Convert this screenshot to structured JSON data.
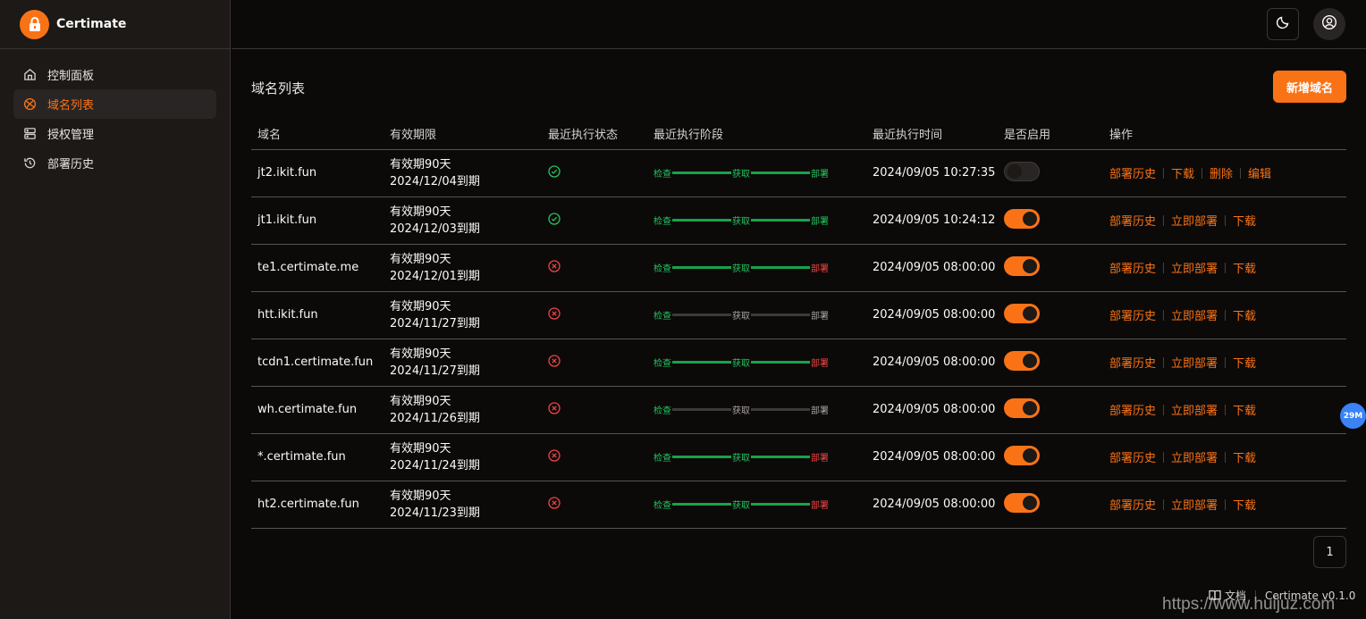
{
  "brand": {
    "name": "Certimate"
  },
  "sidebar": {
    "items": [
      {
        "label": "控制面板",
        "icon": "home-icon",
        "active": false
      },
      {
        "label": "域名列表",
        "icon": "globe-icon",
        "active": true
      },
      {
        "label": "授权管理",
        "icon": "server-icon",
        "active": false
      },
      {
        "label": "部署历史",
        "icon": "history-icon",
        "active": false
      }
    ]
  },
  "header": {
    "theme_icon": "moon-icon",
    "user_icon": "user-circle-icon"
  },
  "main": {
    "title": "域名列表",
    "add_button": "新增域名",
    "columns": [
      "域名",
      "有效期限",
      "最近执行状态",
      "最近执行阶段",
      "最近执行时间",
      "是否启用",
      "操作"
    ],
    "stage_labels": [
      "检查",
      "获取",
      "部署"
    ],
    "rows": [
      {
        "domain": "jt2.ikit.fun",
        "validity": "有效期90天",
        "expiry": "2024/12/04到期",
        "status": "success",
        "stages": [
          "green",
          "green",
          "green"
        ],
        "time": "2024/09/05 10:27:35",
        "enabled": false,
        "actions": [
          "部署历史",
          "下载",
          "删除",
          "编辑"
        ]
      },
      {
        "domain": "jt1.ikit.fun",
        "validity": "有效期90天",
        "expiry": "2024/12/03到期",
        "status": "success",
        "stages": [
          "green",
          "green",
          "green"
        ],
        "time": "2024/09/05 10:24:12",
        "enabled": true,
        "actions": [
          "部署历史",
          "立即部署",
          "下载"
        ]
      },
      {
        "domain": "te1.certimate.me",
        "validity": "有效期90天",
        "expiry": "2024/12/01到期",
        "status": "error",
        "stages": [
          "green",
          "green",
          "red"
        ],
        "time": "2024/09/05 08:00:00",
        "enabled": true,
        "actions": [
          "部署历史",
          "立即部署",
          "下载"
        ]
      },
      {
        "domain": "htt.ikit.fun",
        "validity": "有效期90天",
        "expiry": "2024/11/27到期",
        "status": "error",
        "stages": [
          "green",
          "grey",
          "grey"
        ],
        "time": "2024/09/05 08:00:00",
        "enabled": true,
        "actions": [
          "部署历史",
          "立即部署",
          "下载"
        ]
      },
      {
        "domain": "tcdn1.certimate.fun",
        "validity": "有效期90天",
        "expiry": "2024/11/27到期",
        "status": "error",
        "stages": [
          "green",
          "green",
          "red"
        ],
        "time": "2024/09/05 08:00:00",
        "enabled": true,
        "actions": [
          "部署历史",
          "立即部署",
          "下载"
        ]
      },
      {
        "domain": "wh.certimate.fun",
        "validity": "有效期90天",
        "expiry": "2024/11/26到期",
        "status": "error",
        "stages": [
          "green",
          "grey",
          "grey"
        ],
        "time": "2024/09/05 08:00:00",
        "enabled": true,
        "actions": [
          "部署历史",
          "立即部署",
          "下载"
        ]
      },
      {
        "domain": "*.certimate.fun",
        "validity": "有效期90天",
        "expiry": "2024/11/24到期",
        "status": "error",
        "stages": [
          "green",
          "green",
          "red"
        ],
        "time": "2024/09/05 08:00:00",
        "enabled": true,
        "actions": [
          "部署历史",
          "立即部署",
          "下载"
        ]
      },
      {
        "domain": "ht2.certimate.fun",
        "validity": "有效期90天",
        "expiry": "2024/11/23到期",
        "status": "error",
        "stages": [
          "green",
          "green",
          "red"
        ],
        "time": "2024/09/05 08:00:00",
        "enabled": true,
        "actions": [
          "部署历史",
          "立即部署",
          "下载"
        ]
      }
    ],
    "pagination": {
      "current_page": "1"
    }
  },
  "float_badge": {
    "label": "29M"
  },
  "footer": {
    "docs": "文档",
    "version": "Certimate v0.1.0"
  },
  "watermark": "https://www.huijuz.com",
  "colors": {
    "accent": "#f97316",
    "success": "#22c55e",
    "error": "#ef4444",
    "background": "#0c0a09",
    "sidebar": "#1c1917"
  }
}
